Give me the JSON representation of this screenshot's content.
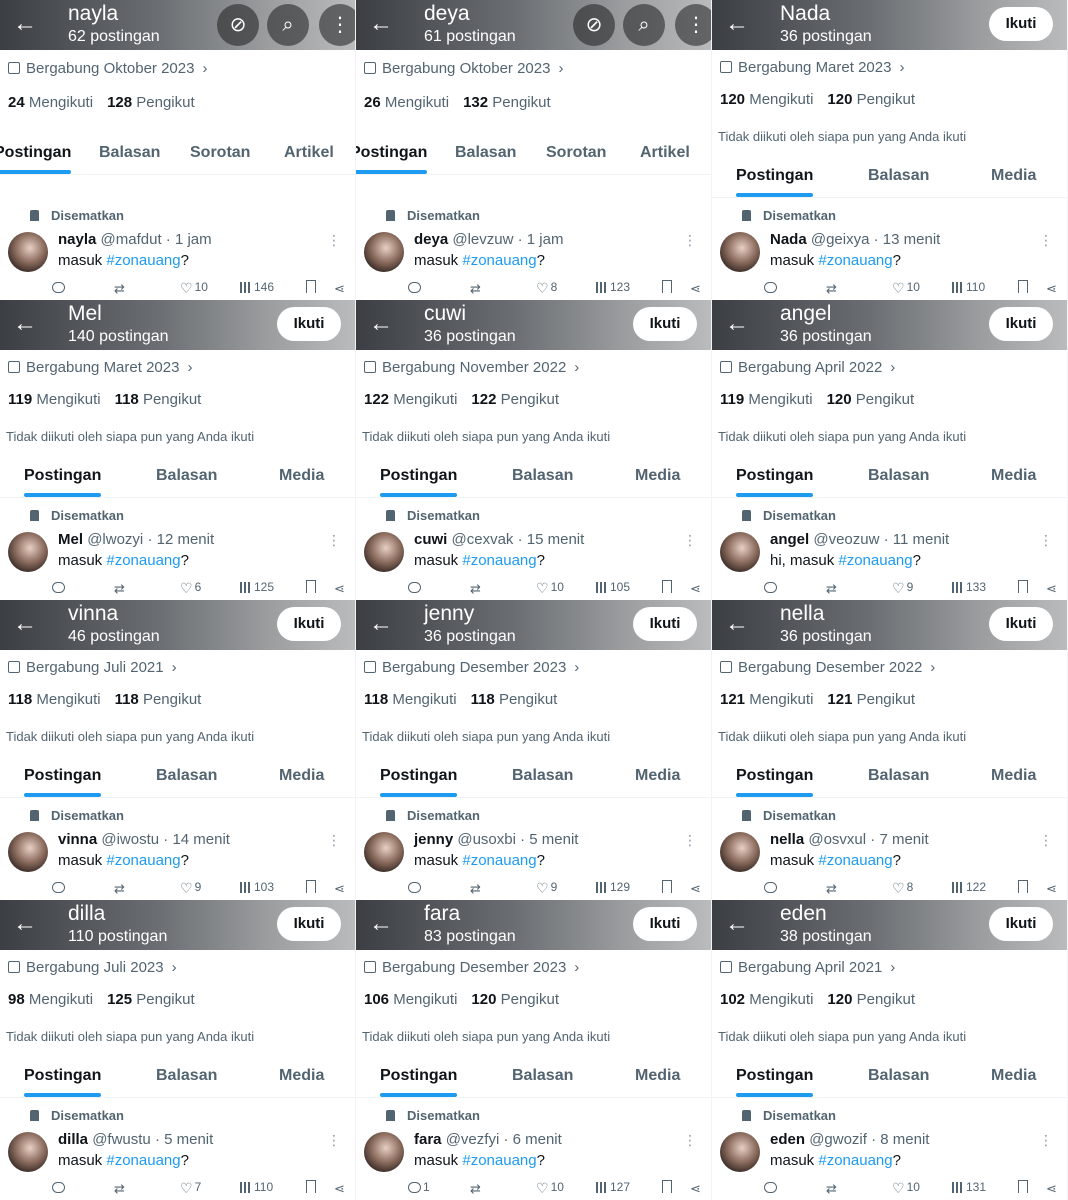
{
  "labels": {
    "follow": "Ikuti",
    "not_followed": "Tidak diikuti oleh siapa pun yang Anda ikuti",
    "pinned": "Disematkan",
    "following_word": "Mengikuti",
    "followers_word": "Pengikut",
    "tab_posts": "Postingan",
    "tab_replies": "Balasan",
    "tab_highlights": "Sorotan",
    "tab_articles": "Artikel",
    "tab_media": "Media",
    "post_prefix": "masuk",
    "hashtag": "#zonauang",
    "post_suffix": "?"
  },
  "colors": {
    "accent": "#1d9bf0",
    "text": "#0f1419",
    "muted": "#536471"
  },
  "profiles": [
    {
      "name": "nayla",
      "posts": "62 postingan",
      "joined": "Bergabung Oktober 2023",
      "following": "24",
      "followers": "128",
      "handle": "@mafdut",
      "time": "· 1 jam",
      "prefix": "masuk",
      "replies": "",
      "likes": "10",
      "views": "146",
      "own": true
    },
    {
      "name": "deya",
      "posts": "61 postingan",
      "joined": "Bergabung Oktober 2023",
      "following": "26",
      "followers": "132",
      "handle": "@levzuw",
      "time": "· 1 jam",
      "prefix": "masuk",
      "replies": "",
      "likes": "8",
      "views": "123",
      "own": true
    },
    {
      "name": "Nada",
      "posts": "36 postingan",
      "joined": "Bergabung Maret 2023",
      "following": "120",
      "followers": "120",
      "handle": "@geixya",
      "time": "· 13 menit",
      "prefix": "masuk",
      "replies": "",
      "likes": "10",
      "views": "110",
      "own": false
    },
    {
      "name": "Mel",
      "posts": "140 postingan",
      "joined": "Bergabung Maret 2023",
      "following": "119",
      "followers": "118",
      "handle": "@lwozyi",
      "time": "· 12 menit",
      "prefix": "masuk",
      "replies": "",
      "likes": "6",
      "views": "125",
      "own": false
    },
    {
      "name": "cuwi",
      "posts": "36 postingan",
      "joined": "Bergabung November 2022",
      "following": "122",
      "followers": "122",
      "handle": "@cexvak",
      "time": "· 15 menit",
      "prefix": "masuk",
      "replies": "",
      "likes": "10",
      "views": "105",
      "own": false
    },
    {
      "name": "angel",
      "posts": "36 postingan",
      "joined": "Bergabung April 2022",
      "following": "119",
      "followers": "120",
      "handle": "@veozuw",
      "time": "· 11 menit",
      "prefix": "hi, masuk",
      "replies": "",
      "likes": "9",
      "views": "133",
      "own": false
    },
    {
      "name": "vinna",
      "posts": "46 postingan",
      "joined": "Bergabung Juli 2021",
      "following": "118",
      "followers": "118",
      "handle": "@iwostu",
      "time": "· 14 menit",
      "prefix": "masuk",
      "replies": "",
      "likes": "9",
      "views": "103",
      "own": false
    },
    {
      "name": "jenny",
      "posts": "36 postingan",
      "joined": "Bergabung Desember 2023",
      "following": "118",
      "followers": "118",
      "handle": "@usoxbi",
      "time": "· 5 menit",
      "prefix": "masuk",
      "replies": "",
      "likes": "9",
      "views": "129",
      "own": false
    },
    {
      "name": "nella",
      "posts": "36 postingan",
      "joined": "Bergabung Desember 2022",
      "following": "121",
      "followers": "121",
      "handle": "@osvxul",
      "time": "· 7 menit",
      "prefix": "masuk",
      "replies": "",
      "likes": "8",
      "views": "122",
      "own": false
    },
    {
      "name": "dilla",
      "posts": "110 postingan",
      "joined": "Bergabung Juli 2023",
      "following": "98",
      "followers": "125",
      "handle": "@fwustu",
      "time": "· 5 menit",
      "prefix": "masuk",
      "replies": "",
      "likes": "7",
      "views": "110",
      "own": false
    },
    {
      "name": "fara",
      "posts": "83 postingan",
      "joined": "Bergabung Desember 2023",
      "following": "106",
      "followers": "120",
      "handle": "@vezfyi",
      "time": "· 6 menit",
      "prefix": "masuk",
      "replies": "1",
      "likes": "10",
      "views": "127",
      "own": false
    },
    {
      "name": "eden",
      "posts": "38 postingan",
      "joined": "Bergabung April 2021",
      "following": "102",
      "followers": "120",
      "handle": "@gwozif",
      "time": "· 8 menit",
      "prefix": "masuk",
      "replies": "",
      "likes": "10",
      "views": "131",
      "own": false
    }
  ]
}
